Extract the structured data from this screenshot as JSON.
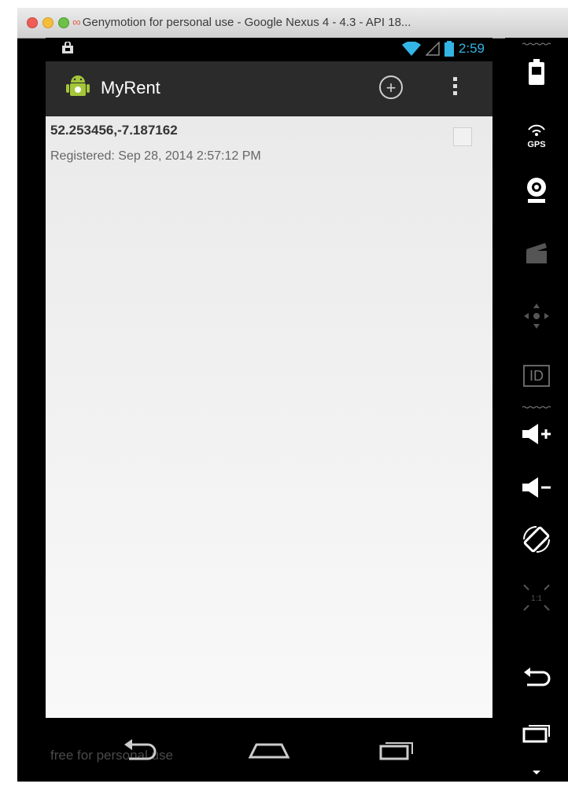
{
  "window": {
    "title": "Genymotion for personal use - Google Nexus 4 - 4.3 - API 18..."
  },
  "status_bar": {
    "time": "2:59"
  },
  "action_bar": {
    "app_title": "MyRent",
    "add_icon": "add-circle-icon",
    "overflow_icon": "overflow-menu-icon"
  },
  "list": {
    "items": [
      {
        "title": "52.253456,-7.187162",
        "subtitle": "Registered: Sep 28, 2014 2:57:12 PM",
        "checked": false
      }
    ]
  },
  "nav_bar": {
    "watermark": "free for personal use",
    "buttons": [
      "back-icon",
      "home-icon",
      "recent-apps-icon"
    ]
  },
  "side_toolbar": {
    "items": [
      {
        "name": "battery-icon"
      },
      {
        "name": "gps-icon",
        "label": "GPS"
      },
      {
        "name": "camera-icon"
      },
      {
        "name": "clapperboard-icon"
      },
      {
        "name": "dpad-icon"
      },
      {
        "name": "id-icon",
        "label": "ID"
      },
      {
        "name": "volume-up-icon"
      },
      {
        "name": "volume-down-icon"
      },
      {
        "name": "rotate-icon"
      },
      {
        "name": "scale-icon",
        "label": "1:1"
      },
      {
        "name": "back-icon"
      },
      {
        "name": "recent-apps-icon"
      },
      {
        "name": "menu-icon"
      }
    ]
  },
  "colors": {
    "accent_blue": "#33b5e5",
    "action_bar": "#2b2b2b",
    "content_bg": "#f0f0f0"
  }
}
